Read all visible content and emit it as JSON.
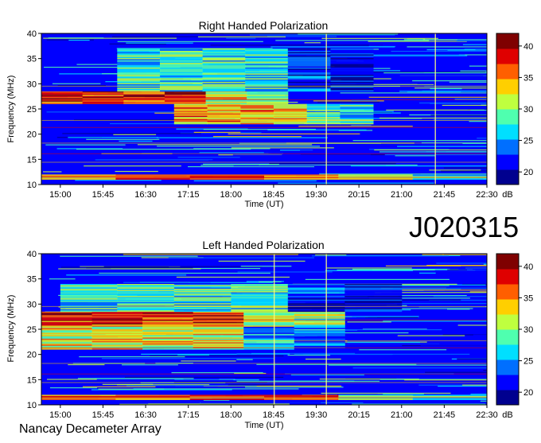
{
  "figure": {
    "observation_id": "J020315",
    "instrument": "Nancay Decameter Array"
  },
  "colorscale": [
    "#00008f",
    "#0000ff",
    "#006fff",
    "#00dfff",
    "#4fffaf",
    "#bfff3f",
    "#ffcf00",
    "#ff5f00",
    "#df0000",
    "#7f0000"
  ],
  "chart_data": [
    {
      "type": "heatmap",
      "title": "Right Handed Polarization",
      "xlabel": "Time (UT)",
      "ylabel": "Frequency (MHz)",
      "x_ticks": [
        "15:00",
        "15:45",
        "16:30",
        "17:15",
        "18:00",
        "18:45",
        "19:30",
        "20:15",
        "21:00",
        "21:45",
        "22:30"
      ],
      "xlim": [
        "14:40",
        "22:30"
      ],
      "y_ticks": [
        10,
        15,
        20,
        25,
        30,
        35,
        40
      ],
      "ylim": [
        10,
        40
      ],
      "colorbar": {
        "label": "dB",
        "ticks": [
          20,
          25,
          30,
          35,
          40
        ],
        "range": [
          18,
          42
        ]
      },
      "emission_bands_mhz": [
        {
          "freq_from": 26.0,
          "freq_to": 28.5,
          "time_from": "14:40",
          "time_to": "19:00",
          "level_db": 38
        },
        {
          "freq_from": 22.0,
          "freq_to": 26.0,
          "time_from": "17:00",
          "time_to": "20:30",
          "level_db": 34
        },
        {
          "freq_from": 28.5,
          "freq_to": 37.0,
          "time_from": "16:00",
          "time_to": "20:30",
          "level_db": 28
        },
        {
          "freq_from": 11.0,
          "freq_to": 12.0,
          "time_from": "14:40",
          "time_to": "22:30",
          "level_db": 36
        }
      ],
      "vertical_bursts": [
        "19:40",
        "21:35"
      ]
    },
    {
      "type": "heatmap",
      "title": "Left Handed Polarization",
      "xlabel": "Time (UT)",
      "ylabel": "Frequency (MHz)",
      "x_ticks": [
        "15:00",
        "15:45",
        "16:30",
        "17:15",
        "18:00",
        "18:45",
        "19:30",
        "20:15",
        "21:00",
        "21:45",
        "22:30"
      ],
      "xlim": [
        "14:40",
        "22:30"
      ],
      "y_ticks": [
        10,
        15,
        20,
        25,
        30,
        35,
        40
      ],
      "ylim": [
        10,
        40
      ],
      "colorbar": {
        "label": "dB",
        "ticks": [
          20,
          25,
          30,
          35,
          40
        ],
        "range": [
          18,
          42
        ]
      },
      "emission_bands_mhz": [
        {
          "freq_from": 25.5,
          "freq_to": 28.5,
          "time_from": "14:40",
          "time_to": "20:00",
          "level_db": 38
        },
        {
          "freq_from": 21.0,
          "freq_to": 25.5,
          "time_from": "14:40",
          "time_to": "20:00",
          "level_db": 32
        },
        {
          "freq_from": 28.5,
          "freq_to": 34.0,
          "time_from": "15:00",
          "time_to": "21:00",
          "level_db": 28
        },
        {
          "freq_from": 11.0,
          "freq_to": 12.0,
          "time_from": "14:40",
          "time_to": "22:30",
          "level_db": 36
        }
      ],
      "vertical_bursts": [
        "18:45",
        "19:40"
      ]
    }
  ]
}
